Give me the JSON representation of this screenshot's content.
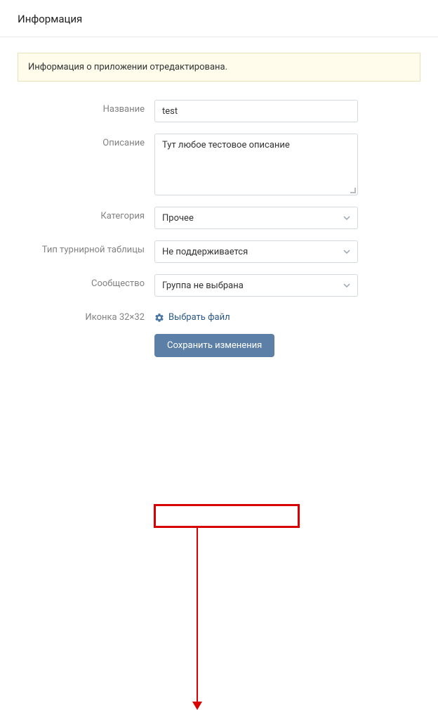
{
  "header": {
    "title": "Информация"
  },
  "notice": {
    "text": "Информация о приложении отредактирована."
  },
  "form": {
    "name": {
      "label": "Название",
      "value": "test"
    },
    "description": {
      "label": "Описание",
      "value": "Тут любое тестовое описание"
    },
    "category": {
      "label": "Категория",
      "value": "Прочее"
    },
    "tournament": {
      "label": "Тип турнирной таблицы",
      "value": "Не поддерживается"
    },
    "community": {
      "label": "Сообщество",
      "value": "Группа не выбрана"
    },
    "icon": {
      "label": "Иконка 32×32",
      "link_text": "Выбрать файл"
    }
  },
  "buttons": {
    "save": "Сохранить изменения"
  }
}
